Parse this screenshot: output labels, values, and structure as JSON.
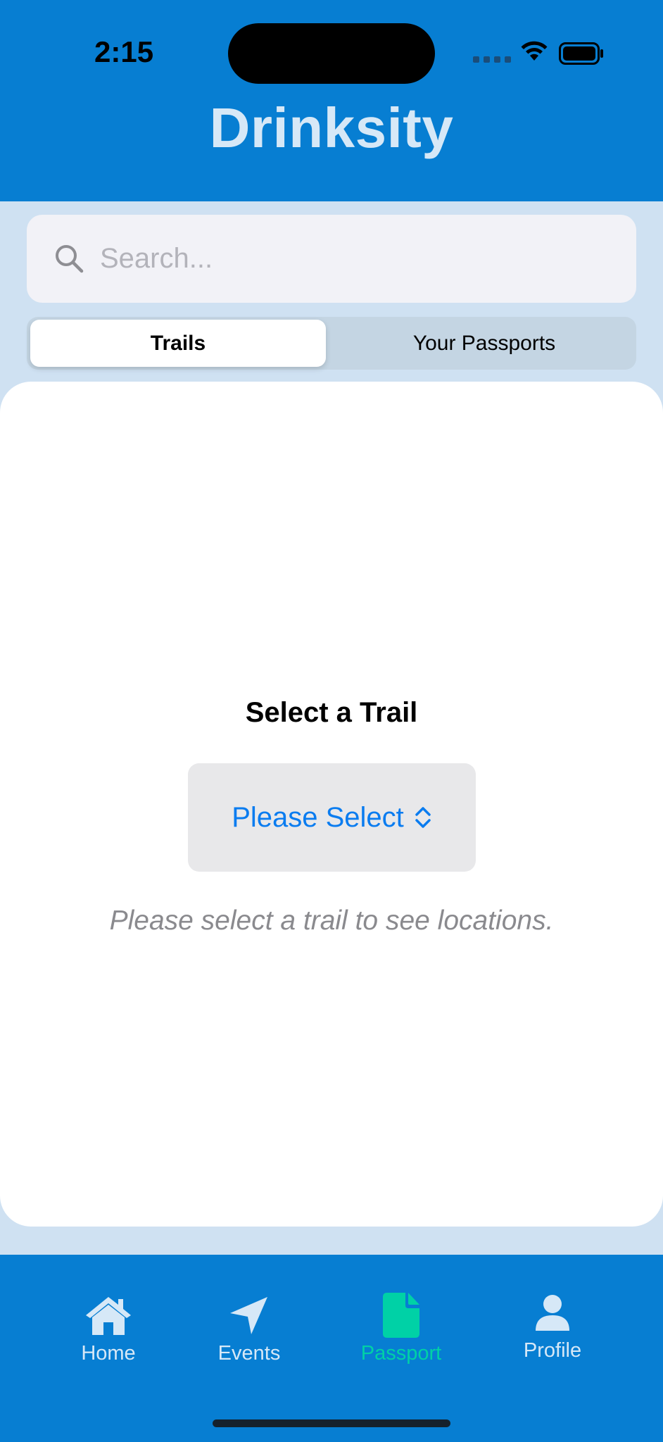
{
  "status_bar": {
    "time": "2:15"
  },
  "header": {
    "title": "Drinksity"
  },
  "search": {
    "placeholder": "Search..."
  },
  "segments": {
    "trails": "Trails",
    "passports": "Your Passports",
    "selected": "Trails"
  },
  "main": {
    "select_title": "Select a Trail",
    "picker_value": "Please Select",
    "hint": "Please select a trail to see locations."
  },
  "tabbar": {
    "items": [
      {
        "label": "Home",
        "icon": "house-icon"
      },
      {
        "label": "Events",
        "icon": "location-arrow-icon"
      },
      {
        "label": "Passport",
        "icon": "document-icon"
      },
      {
        "label": "Profile",
        "icon": "person-icon"
      }
    ],
    "active": "Passport"
  },
  "colors": {
    "primary": "#077ed2",
    "accent_active_tab": "#00d1a6",
    "inactive_tab": "#d6e8f7",
    "link_blue": "#0a7cf0",
    "background": "#cfe1f2"
  }
}
